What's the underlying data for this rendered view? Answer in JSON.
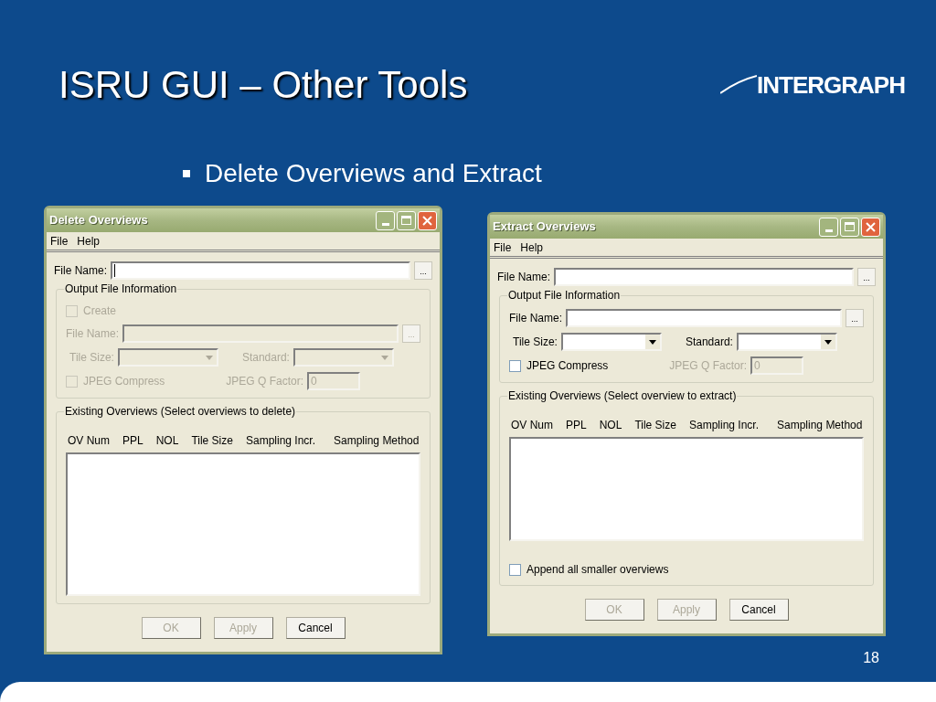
{
  "slide": {
    "title": "ISRU GUI – Other Tools",
    "logo": "INTERGRAPH",
    "bullet": "Delete Overviews and Extract",
    "page_number": "18"
  },
  "windows": [
    {
      "title": "Delete Overviews",
      "menu": [
        "File",
        "Help"
      ],
      "file_name": {
        "label": "File Name:",
        "browse": "...",
        "focused": true
      },
      "output_group": {
        "title": "Output File Information",
        "disabled": true,
        "create": {
          "label": "Create",
          "checked": false
        },
        "file_name_label": "File Name:",
        "browse": "...",
        "tile_size_label": "Tile Size:",
        "standard_label": "Standard:",
        "jpeg_compress": {
          "label": "JPEG Compress",
          "checked": false
        },
        "q_factor": {
          "label": "JPEG Q Factor:",
          "value": "0",
          "disabled": true
        }
      },
      "existing_group": {
        "title": "Existing Overviews (Select overviews to delete)",
        "columns": [
          "OV Num",
          "PPL",
          "NOL",
          "Tile Size",
          "Sampling Incr.",
          "Sampling Method"
        ]
      },
      "buttons": [
        {
          "label": "OK",
          "disabled": true
        },
        {
          "label": "Apply",
          "disabled": true
        },
        {
          "label": "Cancel",
          "disabled": false
        }
      ]
    },
    {
      "title": "Extract Overviews",
      "menu": [
        "File",
        "Help"
      ],
      "file_name": {
        "label": "File Name:",
        "browse": "...",
        "focused": false
      },
      "output_group": {
        "title": "Output File Information",
        "disabled": false,
        "file_name_label": "File Name:",
        "browse": "...",
        "tile_size_label": "Tile Size:",
        "standard_label": "Standard:",
        "jpeg_compress": {
          "label": "JPEG Compress",
          "checked": false
        },
        "q_factor": {
          "label": "JPEG Q Factor:",
          "value": "0",
          "disabled": true
        }
      },
      "existing_group": {
        "title": "Existing Overviews (Select overview to extract)",
        "columns": [
          "OV Num",
          "PPL",
          "NOL",
          "Tile Size",
          "Sampling Incr.",
          "Sampling Method"
        ],
        "append": {
          "label": "Append all smaller overviews",
          "checked": false
        }
      },
      "buttons": [
        {
          "label": "OK",
          "disabled": true
        },
        {
          "label": "Apply",
          "disabled": true
        },
        {
          "label": "Cancel",
          "disabled": false
        }
      ]
    }
  ]
}
